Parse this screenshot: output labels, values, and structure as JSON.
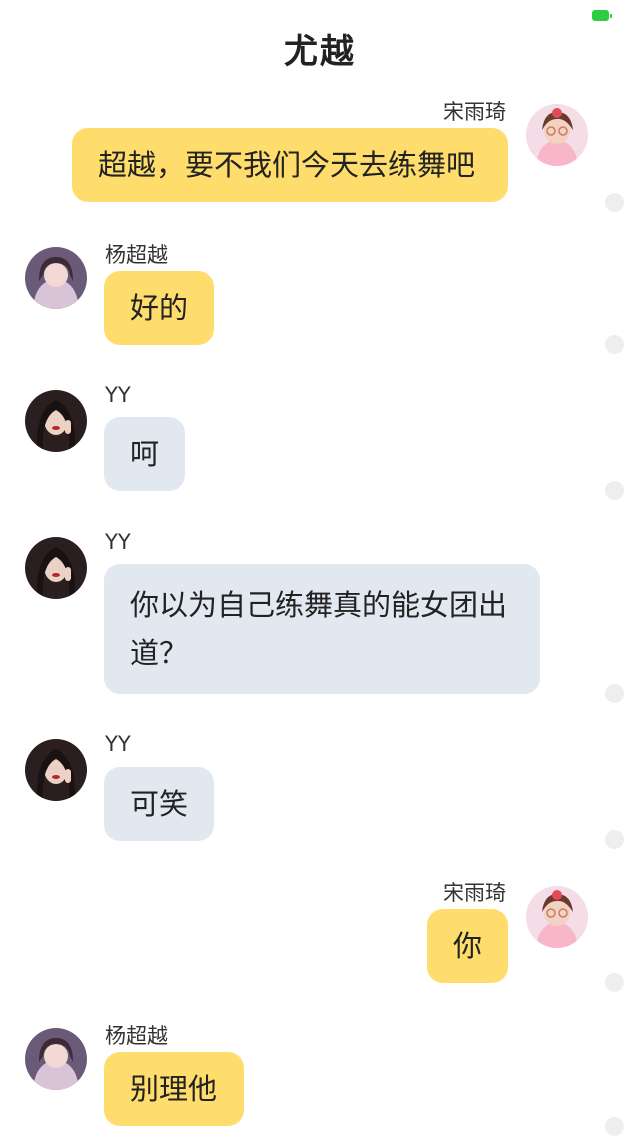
{
  "header": {
    "title": "尤越",
    "battery_color": "#2ecc40"
  },
  "colors": {
    "yellow_bubble": "#fedd6d",
    "gray_bubble": "#e2e8f0",
    "status_dot": "#eeeeee"
  },
  "messages": [
    {
      "sender": "宋雨琦",
      "side": "right",
      "text": "超越，要不我们今天去练舞吧",
      "bubble": "yellow",
      "avatar": "avatar-song-yuqi"
    },
    {
      "sender": "杨超越",
      "side": "left",
      "text": "好的",
      "bubble": "yellow",
      "avatar": "avatar-yang-chaoyue"
    },
    {
      "sender": "YY",
      "side": "left",
      "text": "呵",
      "bubble": "gray",
      "avatar": "avatar-yy"
    },
    {
      "sender": "YY",
      "side": "left",
      "text_lines": [
        "你以为自己练舞真的能女团出",
        "道？"
      ],
      "bubble": "gray",
      "avatar": "avatar-yy"
    },
    {
      "sender": "YY",
      "side": "left",
      "text": "可笑",
      "bubble": "gray",
      "avatar": "avatar-yy"
    },
    {
      "sender": "宋雨琦",
      "side": "right",
      "text": "你",
      "bubble": "yellow",
      "avatar": "avatar-song-yuqi"
    },
    {
      "sender": "杨超越",
      "side": "left",
      "text": "别理他",
      "bubble": "yellow",
      "avatar": "avatar-yang-chaoyue"
    }
  ]
}
